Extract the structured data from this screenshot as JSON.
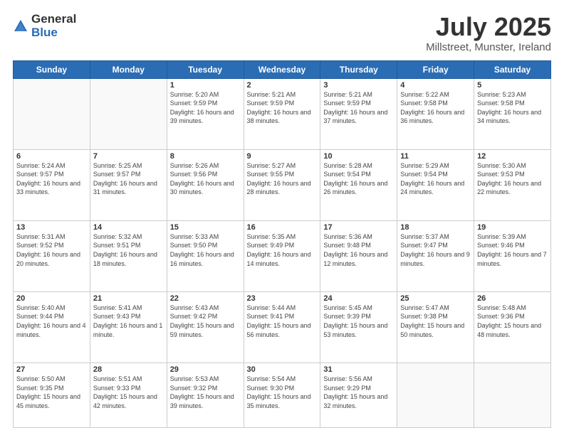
{
  "logo": {
    "general": "General",
    "blue": "Blue"
  },
  "header": {
    "title": "July 2025",
    "location": "Millstreet, Munster, Ireland"
  },
  "days_of_week": [
    "Sunday",
    "Monday",
    "Tuesday",
    "Wednesday",
    "Thursday",
    "Friday",
    "Saturday"
  ],
  "weeks": [
    [
      {
        "day": "",
        "info": ""
      },
      {
        "day": "",
        "info": ""
      },
      {
        "day": "1",
        "info": "Sunrise: 5:20 AM\nSunset: 9:59 PM\nDaylight: 16 hours and 39 minutes."
      },
      {
        "day": "2",
        "info": "Sunrise: 5:21 AM\nSunset: 9:59 PM\nDaylight: 16 hours and 38 minutes."
      },
      {
        "day": "3",
        "info": "Sunrise: 5:21 AM\nSunset: 9:59 PM\nDaylight: 16 hours and 37 minutes."
      },
      {
        "day": "4",
        "info": "Sunrise: 5:22 AM\nSunset: 9:58 PM\nDaylight: 16 hours and 36 minutes."
      },
      {
        "day": "5",
        "info": "Sunrise: 5:23 AM\nSunset: 9:58 PM\nDaylight: 16 hours and 34 minutes."
      }
    ],
    [
      {
        "day": "6",
        "info": "Sunrise: 5:24 AM\nSunset: 9:57 PM\nDaylight: 16 hours and 33 minutes."
      },
      {
        "day": "7",
        "info": "Sunrise: 5:25 AM\nSunset: 9:57 PM\nDaylight: 16 hours and 31 minutes."
      },
      {
        "day": "8",
        "info": "Sunrise: 5:26 AM\nSunset: 9:56 PM\nDaylight: 16 hours and 30 minutes."
      },
      {
        "day": "9",
        "info": "Sunrise: 5:27 AM\nSunset: 9:55 PM\nDaylight: 16 hours and 28 minutes."
      },
      {
        "day": "10",
        "info": "Sunrise: 5:28 AM\nSunset: 9:54 PM\nDaylight: 16 hours and 26 minutes."
      },
      {
        "day": "11",
        "info": "Sunrise: 5:29 AM\nSunset: 9:54 PM\nDaylight: 16 hours and 24 minutes."
      },
      {
        "day": "12",
        "info": "Sunrise: 5:30 AM\nSunset: 9:53 PM\nDaylight: 16 hours and 22 minutes."
      }
    ],
    [
      {
        "day": "13",
        "info": "Sunrise: 5:31 AM\nSunset: 9:52 PM\nDaylight: 16 hours and 20 minutes."
      },
      {
        "day": "14",
        "info": "Sunrise: 5:32 AM\nSunset: 9:51 PM\nDaylight: 16 hours and 18 minutes."
      },
      {
        "day": "15",
        "info": "Sunrise: 5:33 AM\nSunset: 9:50 PM\nDaylight: 16 hours and 16 minutes."
      },
      {
        "day": "16",
        "info": "Sunrise: 5:35 AM\nSunset: 9:49 PM\nDaylight: 16 hours and 14 minutes."
      },
      {
        "day": "17",
        "info": "Sunrise: 5:36 AM\nSunset: 9:48 PM\nDaylight: 16 hours and 12 minutes."
      },
      {
        "day": "18",
        "info": "Sunrise: 5:37 AM\nSunset: 9:47 PM\nDaylight: 16 hours and 9 minutes."
      },
      {
        "day": "19",
        "info": "Sunrise: 5:39 AM\nSunset: 9:46 PM\nDaylight: 16 hours and 7 minutes."
      }
    ],
    [
      {
        "day": "20",
        "info": "Sunrise: 5:40 AM\nSunset: 9:44 PM\nDaylight: 16 hours and 4 minutes."
      },
      {
        "day": "21",
        "info": "Sunrise: 5:41 AM\nSunset: 9:43 PM\nDaylight: 16 hours and 1 minute."
      },
      {
        "day": "22",
        "info": "Sunrise: 5:43 AM\nSunset: 9:42 PM\nDaylight: 15 hours and 59 minutes."
      },
      {
        "day": "23",
        "info": "Sunrise: 5:44 AM\nSunset: 9:41 PM\nDaylight: 15 hours and 56 minutes."
      },
      {
        "day": "24",
        "info": "Sunrise: 5:45 AM\nSunset: 9:39 PM\nDaylight: 15 hours and 53 minutes."
      },
      {
        "day": "25",
        "info": "Sunrise: 5:47 AM\nSunset: 9:38 PM\nDaylight: 15 hours and 50 minutes."
      },
      {
        "day": "26",
        "info": "Sunrise: 5:48 AM\nSunset: 9:36 PM\nDaylight: 15 hours and 48 minutes."
      }
    ],
    [
      {
        "day": "27",
        "info": "Sunrise: 5:50 AM\nSunset: 9:35 PM\nDaylight: 15 hours and 45 minutes."
      },
      {
        "day": "28",
        "info": "Sunrise: 5:51 AM\nSunset: 9:33 PM\nDaylight: 15 hours and 42 minutes."
      },
      {
        "day": "29",
        "info": "Sunrise: 5:53 AM\nSunset: 9:32 PM\nDaylight: 15 hours and 39 minutes."
      },
      {
        "day": "30",
        "info": "Sunrise: 5:54 AM\nSunset: 9:30 PM\nDaylight: 15 hours and 35 minutes."
      },
      {
        "day": "31",
        "info": "Sunrise: 5:56 AM\nSunset: 9:29 PM\nDaylight: 15 hours and 32 minutes."
      },
      {
        "day": "",
        "info": ""
      },
      {
        "day": "",
        "info": ""
      }
    ]
  ]
}
